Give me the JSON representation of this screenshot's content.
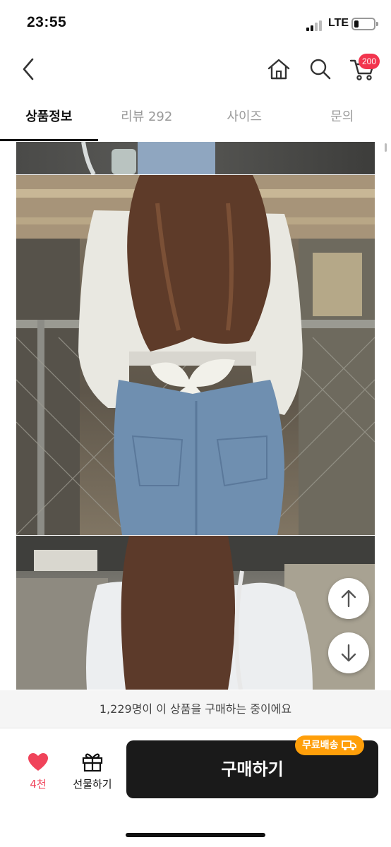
{
  "status_bar": {
    "time": "23:55",
    "network": "LTE"
  },
  "header": {
    "cart_count": "200",
    "icons": [
      "back-icon",
      "home-icon",
      "search-icon",
      "cart-icon"
    ]
  },
  "tabs": [
    {
      "label": "상품정보",
      "active": true
    },
    {
      "label": "리뷰 292",
      "active": false
    },
    {
      "label": "사이즈",
      "active": false
    },
    {
      "label": "문의",
      "active": false
    }
  ],
  "notice": {
    "text": "1,229명이 이 상품을 구매하는 중이에요"
  },
  "bottom_bar": {
    "like_count": "4천",
    "gift_label": "선물하기",
    "buy_label": "구매하기",
    "free_shipping_label": "무료배송"
  },
  "colors": {
    "accent_red": "#f0435a",
    "badge_red": "#f2354e",
    "free_ship_orange": "#ff9f0a",
    "buy_button": "#1a1a1a"
  }
}
